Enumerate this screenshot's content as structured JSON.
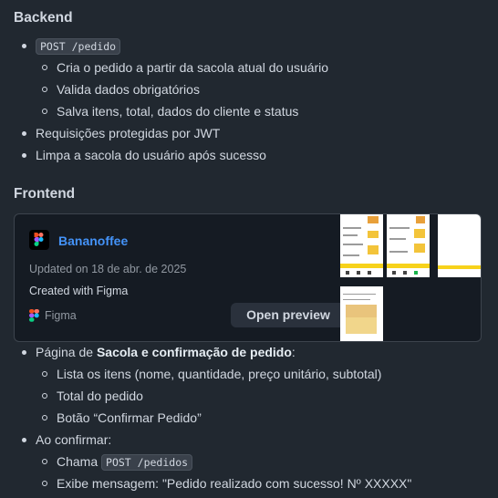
{
  "backend": {
    "heading": "Backend",
    "endpoint_code": "POST /pedido",
    "endpoint_subitems": [
      "Cria o pedido a partir da sacola atual do usuário",
      "Valida dados obrigatórios",
      "Salva itens, total, dados do cliente e status"
    ],
    "item_jwt": "Requisições protegidas por JWT",
    "item_clear": "Limpa a sacola do usuário após sucesso"
  },
  "frontend": {
    "heading": "Frontend",
    "embed": {
      "title": "Bananoffee",
      "updated": "Updated on 18 de abr. de 2025",
      "created": "Created with Figma",
      "source": "Figma",
      "open_preview": "Open preview",
      "logo_icon": "figma-logo-icon"
    },
    "page_prefix": "Página de ",
    "page_bold": "Sacola e confirmação de pedido",
    "page_suffix": ":",
    "page_subitems": [
      "Lista os itens (nome, quantidade, preço unitário, subtotal)",
      "Total do pedido",
      "Botão “Confirmar Pedido”"
    ],
    "confirm_item": "Ao confirmar:",
    "confirm_call_prefix": "Chama ",
    "confirm_call_code": "POST /pedidos",
    "confirm_message": "Exibe mensagem: \"Pedido realizado com sucesso! Nº XXXXX\""
  },
  "colors": {
    "background": "#212830",
    "text": "#d1d7e0",
    "link": "#4493f8",
    "card_bg": "#151b23",
    "accent_yellow": "#f7d21b"
  }
}
